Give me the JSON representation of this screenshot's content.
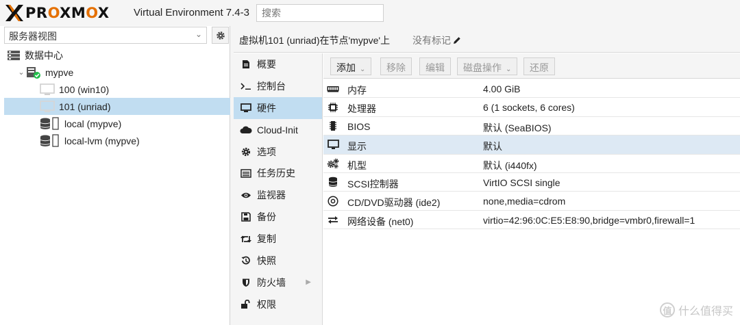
{
  "header": {
    "logo_text": "PROXMOX",
    "version": "Virtual Environment 7.4-3",
    "search_placeholder": "搜索"
  },
  "left": {
    "view_select": "服务器视图",
    "tree": [
      {
        "label": "数据中心",
        "icon": "datacenter-icon",
        "level": 0
      },
      {
        "label": "mypve",
        "icon": "node-online-icon",
        "level": 1,
        "expanded": true
      },
      {
        "label": "100 (win10)",
        "icon": "vm-monitor-icon",
        "level": 2
      },
      {
        "label": "101 (unriad)",
        "icon": "vm-monitor-icon",
        "level": 2,
        "selected": true
      },
      {
        "label": "local (mypve)",
        "icon": "storage-icon",
        "level": 2
      },
      {
        "label": "local-lvm (mypve)",
        "icon": "storage-icon",
        "level": 2
      }
    ]
  },
  "vm": {
    "title": "虚拟机101 (unriad)在节点'mypve'上",
    "tags_label": "没有标记"
  },
  "menu": [
    {
      "label": "概要",
      "icon": "summary-icon"
    },
    {
      "label": "控制台",
      "icon": "console-icon"
    },
    {
      "label": "硬件",
      "icon": "hardware-icon",
      "active": true
    },
    {
      "label": "Cloud-Init",
      "icon": "cloud-icon"
    },
    {
      "label": "选项",
      "icon": "options-gear-icon"
    },
    {
      "label": "任务历史",
      "icon": "task-list-icon"
    },
    {
      "label": "监视器",
      "icon": "eye-icon"
    },
    {
      "label": "备份",
      "icon": "floppy-icon"
    },
    {
      "label": "复制",
      "icon": "retweet-icon"
    },
    {
      "label": "快照",
      "icon": "history-icon"
    },
    {
      "label": "防火墙",
      "icon": "shield-icon",
      "has_submenu": true
    },
    {
      "label": "权限",
      "icon": "unlock-icon"
    }
  ],
  "toolbar": {
    "add": "添加",
    "remove": "移除",
    "edit": "编辑",
    "disk_action": "磁盘操作",
    "revert": "还原"
  },
  "hardware": [
    {
      "name": "内存",
      "value": "4.00 GiB",
      "icon": "memory-icon"
    },
    {
      "name": "处理器",
      "value": "6 (1 sockets, 6 cores)",
      "icon": "cpu-icon"
    },
    {
      "name": "BIOS",
      "value": "默认 (SeaBIOS)",
      "icon": "bios-chip-icon"
    },
    {
      "name": "显示",
      "value": "默认",
      "icon": "display-icon",
      "selected": true
    },
    {
      "name": "机型",
      "value": "默认 (i440fx)",
      "icon": "machine-cogs-icon"
    },
    {
      "name": "SCSI控制器",
      "value": "VirtIO SCSI single",
      "icon": "database-icon"
    },
    {
      "name": "CD/DVD驱动器 (ide2)",
      "value": "none,media=cdrom",
      "icon": "cdrom-icon"
    },
    {
      "name": "网络设备 (net0)",
      "value": "virtio=42:96:0C:E5:E8:90,bridge=vmbr0,firewall=1",
      "icon": "network-exchange-icon"
    }
  ],
  "watermark": {
    "badge": "值",
    "text": "什么值得买"
  }
}
